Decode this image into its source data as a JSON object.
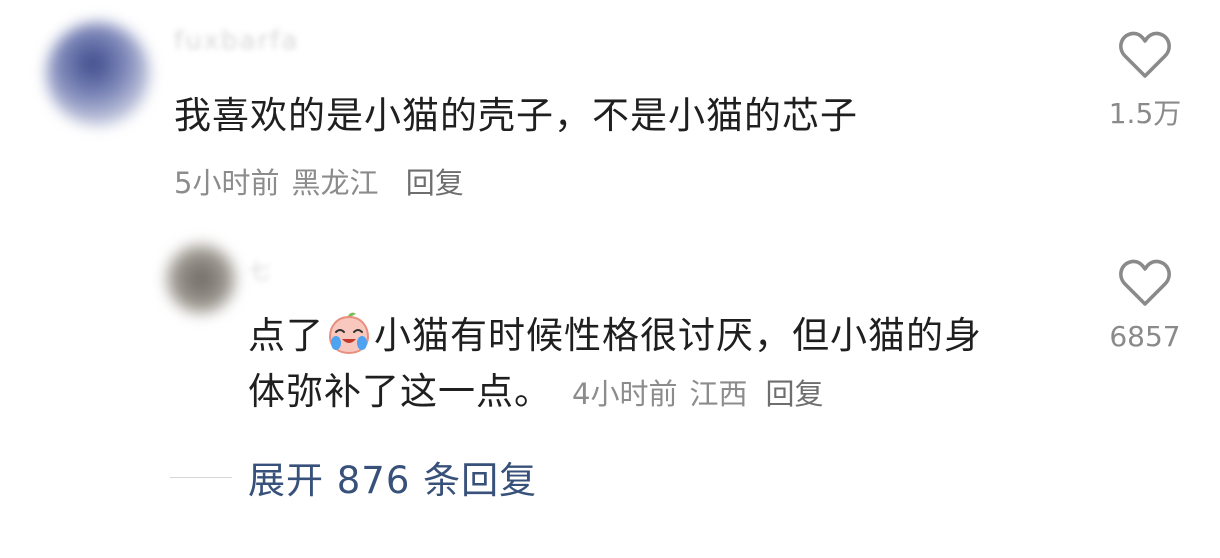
{
  "comments": [
    {
      "username": "fuxbarfa",
      "text": "我喜欢的是小猫的壳子，不是小猫的芯子",
      "time": "5小时前",
      "location": "黑龙江",
      "reply_label": "回复",
      "like_icon": "heart-outline-icon",
      "like_count": "1.5万"
    },
    {
      "username": "七",
      "text_before_emoji": "点了",
      "emoji": "crying-laughing-peach-emoji",
      "text_after_emoji_line1": "小猫有时候性格很讨厌，但小猫的身",
      "text_line2": "体弥补了这一点。",
      "time": "4小时前",
      "location": "江西",
      "reply_label": "回复",
      "like_icon": "heart-outline-icon",
      "like_count": "6857"
    }
  ],
  "expand_replies": {
    "label": "展开 876 条回复"
  },
  "colors": {
    "text": "#1f1f1f",
    "meta": "#8c8c8c",
    "link": "#38517a",
    "icon": "#8a8a8a"
  }
}
